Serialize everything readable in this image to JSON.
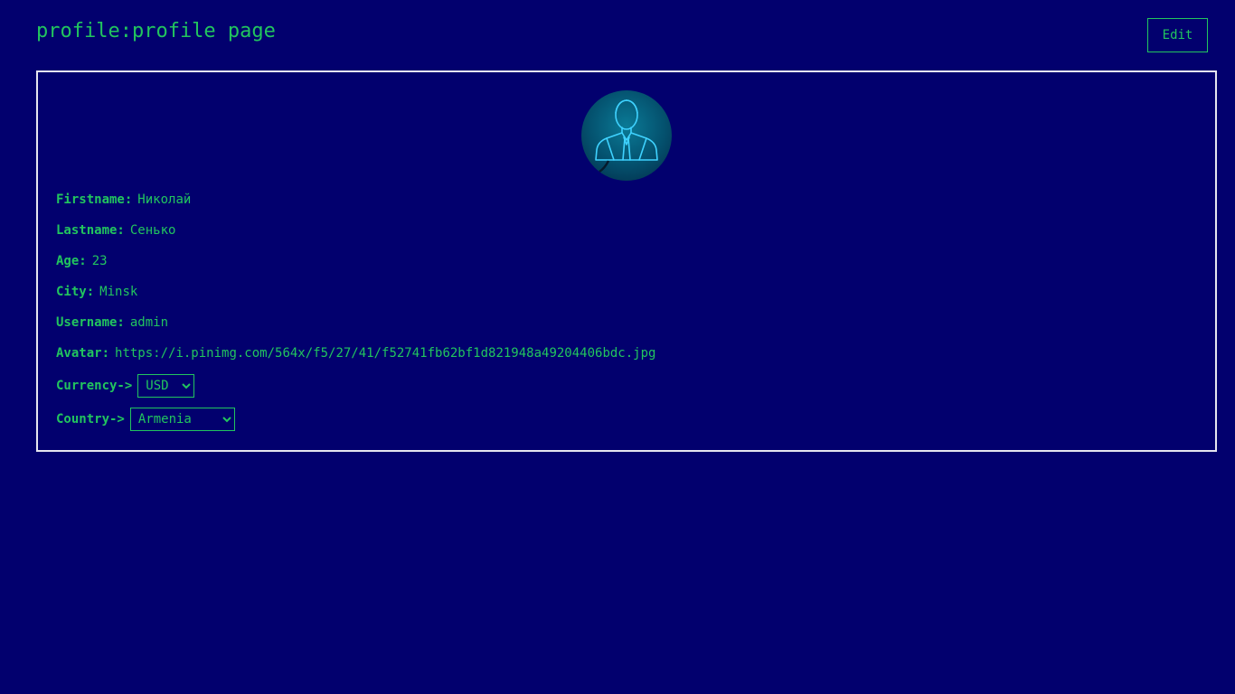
{
  "header": {
    "title": "profile:profile page",
    "edit_label": "Edit"
  },
  "profile": {
    "avatar_icon": "user-avatar-icon",
    "fields": [
      {
        "label": "Firstname:",
        "value": "Николай"
      },
      {
        "label": "Lastname:",
        "value": "Сенько"
      },
      {
        "label": "Age:",
        "value": "23"
      },
      {
        "label": "City:",
        "value": "Minsk"
      },
      {
        "label": "Username:",
        "value": "admin"
      },
      {
        "label": "Avatar:",
        "value": "https://i.pinimg.com/564x/f5/27/41/f52741fb62bf1d821948a49204406bdc.jpg"
      }
    ],
    "currency": {
      "label": "Currency->",
      "selected": "USD"
    },
    "country": {
      "label": "Country->",
      "selected": "Armenia"
    }
  },
  "colors": {
    "background": "#02006e",
    "accent": "#22c55e",
    "border": "#e6e6f0"
  }
}
